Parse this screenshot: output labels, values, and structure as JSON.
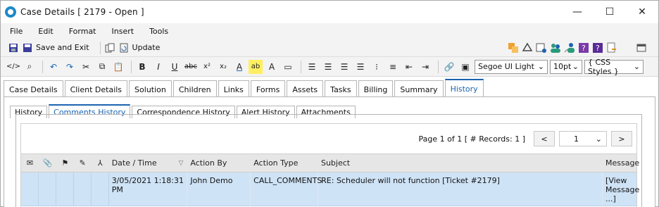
{
  "window": {
    "title": "Case Details [ 2179 - Open ]",
    "controls": [
      "—",
      "☐",
      "✕"
    ]
  },
  "menu": [
    "File",
    "Edit",
    "Format",
    "Insert",
    "Tools"
  ],
  "toolbar": {
    "save_and_exit": "Save and Exit",
    "update": "Update"
  },
  "format_bar": {
    "font": "Segoe UI Light",
    "size": "10pt",
    "styles": "{ CSS Styles }"
  },
  "main_tabs": [
    "Case Details",
    "Client Details",
    "Solution",
    "Children",
    "Links",
    "Forms",
    "Assets",
    "Tasks",
    "Billing",
    "Summary",
    "History"
  ],
  "main_tab_active": "History",
  "sub_tabs": [
    "History",
    "Comments History",
    "Correspondence History",
    "Alert History",
    "Attachments"
  ],
  "sub_tab_active": "Comments History",
  "pager": {
    "text": "Page 1 of 1 [ # Records: 1 ]",
    "prev": "<",
    "page": "1",
    "next": ">"
  },
  "grid": {
    "columns": [
      "Date / Time",
      "Action By",
      "Action Type",
      "Subject",
      "Message"
    ],
    "rows": [
      {
        "datetime": "3/05/2021 1:18:31 PM",
        "action_by": "John Demo",
        "action_type": "CALL_COMMENTS",
        "subject": "RE: Scheduler will not function [Ticket #2179]",
        "message": "[View Message ...]"
      }
    ]
  },
  "colors": {
    "accent": "#1a63b0",
    "row_selected": "#cfe3f6",
    "header_bg": "#e6e6e6"
  }
}
